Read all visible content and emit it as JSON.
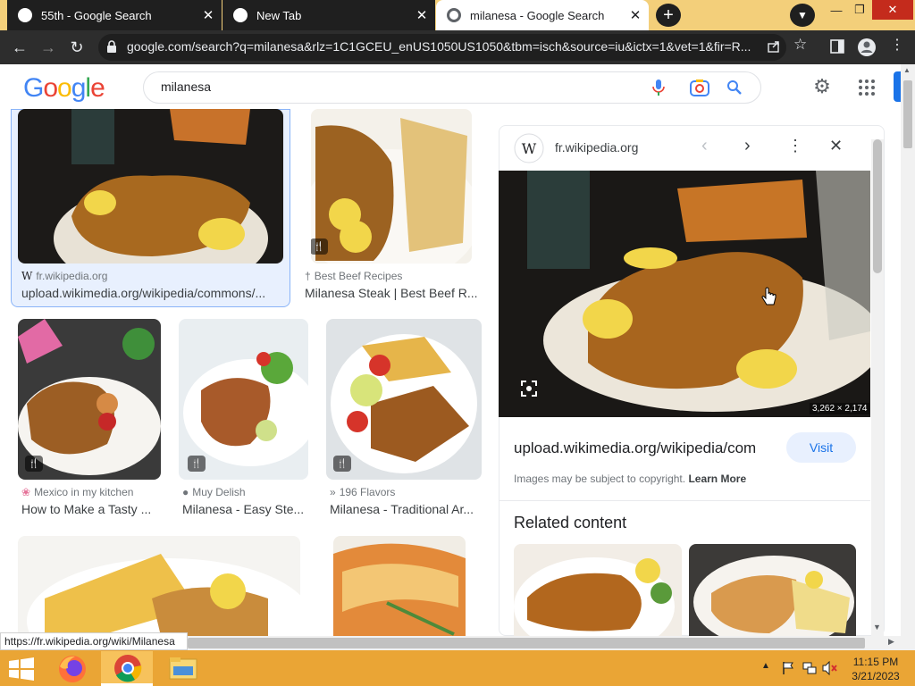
{
  "browser": {
    "tabs": [
      {
        "title": "55th - Google Search",
        "active": false
      },
      {
        "title": "New Tab",
        "active": false
      },
      {
        "title": "milanesa - Google Search",
        "active": true
      }
    ],
    "new_tab_symbol": "+",
    "url_display": "google.com/search?q=milanesa&rlz=1C1GCEU_enUS1050US1050&tbm=isch&source=iu&ictx=1&vet=1&fir=R...",
    "status_url": "https://fr.wikipedia.org/wiki/Milanesa"
  },
  "search": {
    "logo": [
      "G",
      "o",
      "o",
      "g",
      "l",
      "e"
    ],
    "query": "milanesa"
  },
  "results": [
    {
      "source": "fr.wikipedia.org",
      "title": "upload.wikimedia.org/wikipedia/commons/..."
    },
    {
      "source": "Best Beef Recipes",
      "title": "Milanesa Steak | Best Beef R..."
    },
    {
      "source": "Mexico in my kitchen",
      "title": "How to Make a Tasty ..."
    },
    {
      "source": "Muy Delish",
      "title": "Milanesa - Easy Ste..."
    },
    {
      "source": "196 Flavors",
      "title": "Milanesa - Traditional Ar..."
    }
  ],
  "panel": {
    "site": "fr.wikipedia.org",
    "dimensions": "3,262 × 2,174",
    "link_text": "upload.wikimedia.org/wikipedia/com",
    "visit_label": "Visit",
    "copyright_text": "Images may be subject to copyright.",
    "learn_more": "Learn More",
    "related_heading": "Related content"
  },
  "taskbar": {
    "time": "11:15 PM",
    "date": "3/21/2023"
  },
  "colors": {
    "tabbar": "#f3cf7a",
    "toolbar": "#2d2d2d",
    "taskbar": "#eaa535",
    "google_blue": "#4285f4",
    "google_red": "#ea4335",
    "google_yellow": "#fbbc05",
    "google_green": "#34a853",
    "visit_button": "#e8f0fe"
  }
}
